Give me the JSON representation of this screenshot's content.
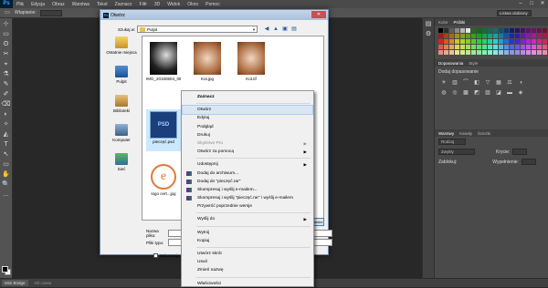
{
  "app": {
    "menu": [
      "Plik",
      "Edycja",
      "Obraz",
      "Warstwa",
      "Tekst",
      "Zaznacz",
      "Filtr",
      "3D",
      "Widok",
      "Okno",
      "Pomoc"
    ],
    "logo": "Ps",
    "options": {
      "feather_label": "Wtapianie:",
      "workspace": "Listwa ulubiony"
    },
    "window_controls": [
      "–",
      "□",
      "✕"
    ],
    "tools": [
      "⊹",
      "▭",
      "ʘ",
      "✂",
      "⌖",
      "⚗",
      "✎",
      "✐",
      "⌫",
      "◐",
      "✧",
      "◭",
      "T",
      "↖",
      "▭",
      "✋",
      "🔍",
      "…"
    ],
    "colors": {
      "fg": "#000000",
      "bg": "#ffffff"
    }
  },
  "panels": {
    "color_tabs": [
      "Kolor",
      "Próbki"
    ],
    "adjust_tabs": [
      "Dopasowania",
      "Style"
    ],
    "adjust_title": "Dodaj dopasowanie",
    "layers_tabs": [
      "Warstwy",
      "Kanały",
      "Ścieżki"
    ],
    "layers_kind": "Rodzaj",
    "layers_blend": "Zwykły",
    "layers_opacity_label": "Krycie:",
    "layers_lock_label": "Zablokuj:",
    "layers_fill_label": "Wypełnienie:"
  },
  "bottom": {
    "tabs": [
      "Mini Bridge",
      "Oś czasu"
    ]
  },
  "dialog": {
    "title": "Otwórz",
    "lookin_label": "Szukaj w:",
    "lookin_value": "Pulpit",
    "nav": [
      "◀",
      "▲",
      "▣",
      "▤"
    ],
    "places": [
      "Ostatnie miejsca",
      "Pulpit",
      "Biblioteki",
      "Komputer",
      "Sieć"
    ],
    "files": [
      "IMG_20150604_08...",
      "Kot.jpg",
      "Kot.tif",
      "pieczęć.psd",
      "logo cert...jpg"
    ],
    "psd_badge": "PSD",
    "filename_label": "Nazwa pliku:",
    "filetype_label": "Pliki typu:",
    "sequence_label": "Sekwencja",
    "open_button": "Otwórz"
  },
  "context_menu": {
    "items": [
      {
        "label": "Zaznacz",
        "bold": true
      },
      {
        "sep": true
      },
      {
        "label": "Otwórz",
        "highlight": true
      },
      {
        "label": "Edytuj"
      },
      {
        "label": "Podgląd"
      },
      {
        "label": "Drukuj"
      },
      {
        "label": "SkyDrive Pro",
        "disabled": true,
        "arrow": true
      },
      {
        "label": "Otwórz za pomocą",
        "arrow": true
      },
      {
        "sep": true
      },
      {
        "label": "Udostępnij",
        "arrow": true
      },
      {
        "label": "Dodaj do archiwum...",
        "icon": "rar"
      },
      {
        "label": "Dodaj do \"pieczęć.rar\"",
        "icon": "rar"
      },
      {
        "label": "Skompresuj i wyślij e-mailem...",
        "icon": "rar"
      },
      {
        "label": "Skompresuj i wyślij \"pieczęć.rar\" i wyślij e-mailem",
        "icon": "rar"
      },
      {
        "label": "Przywróć poprzednie wersje"
      },
      {
        "sep": true
      },
      {
        "label": "Wyślij do",
        "arrow": true
      },
      {
        "sep": true
      },
      {
        "label": "Wytnij"
      },
      {
        "label": "Kopiuj"
      },
      {
        "sep": true
      },
      {
        "label": "Utwórz skrót"
      },
      {
        "label": "Usuń"
      },
      {
        "label": "Zmień nazwę"
      },
      {
        "sep": true
      },
      {
        "label": "Właściwości"
      }
    ]
  }
}
